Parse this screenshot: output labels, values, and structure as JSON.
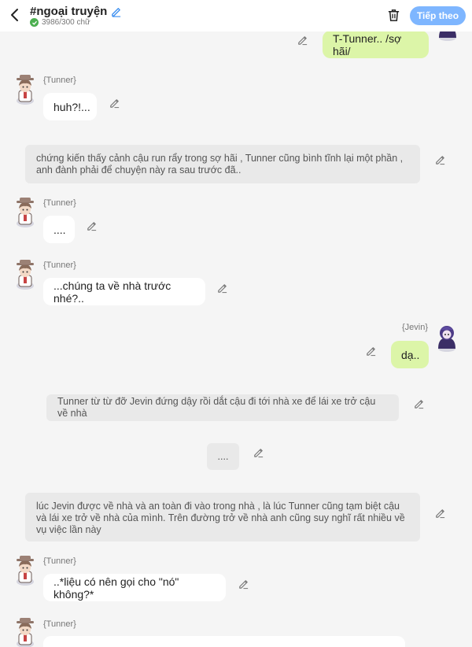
{
  "header": {
    "title": "#ngoại truyện",
    "word_count": "3986/300 chữ",
    "next_label": "Tiếp theo"
  },
  "colors": {
    "accent": "#7eb6ff",
    "mine_bubble": "#dcf5a8",
    "narration": "#e9e9e9"
  },
  "messages": [
    {
      "text": "T-Tunner.. /sợ hãi/"
    },
    {
      "name": "{Tunner}",
      "text": "huh?!..."
    },
    {
      "text": "chứng kiến thấy cảnh cậu run rẩy trong sợ hãi , Tunner cũng bình tĩnh lại một phần , anh đành phải để chuyện này ra sau trước đã.."
    },
    {
      "name": "{Tunner}",
      "text": "...."
    },
    {
      "name": "{Tunner}",
      "text": "...chúng ta về nhà trước nhé?.."
    },
    {
      "name": "{Jevin}",
      "text": "dạ.."
    },
    {
      "text": "Tunner từ từ đỡ Jevin đứng dậy rồi dắt cậu đi tới nhà xe để lái xe trở cậu về nhà"
    },
    {
      "text": "...."
    },
    {
      "text": "lúc Jevin được về nhà và an toàn đi vào trong nhà , là lúc Tunner cũng tạm biệt cậu và lái xe trở về nhà của mình. Trên đường trở về nhà anh cũng suy nghĩ rất nhiều về vụ việc lần này"
    },
    {
      "name": "{Tunner}",
      "text": "..*liệu có nên gọi cho \"nó\" không?*"
    },
    {
      "name": "{Tunner}",
      "text": ""
    }
  ]
}
